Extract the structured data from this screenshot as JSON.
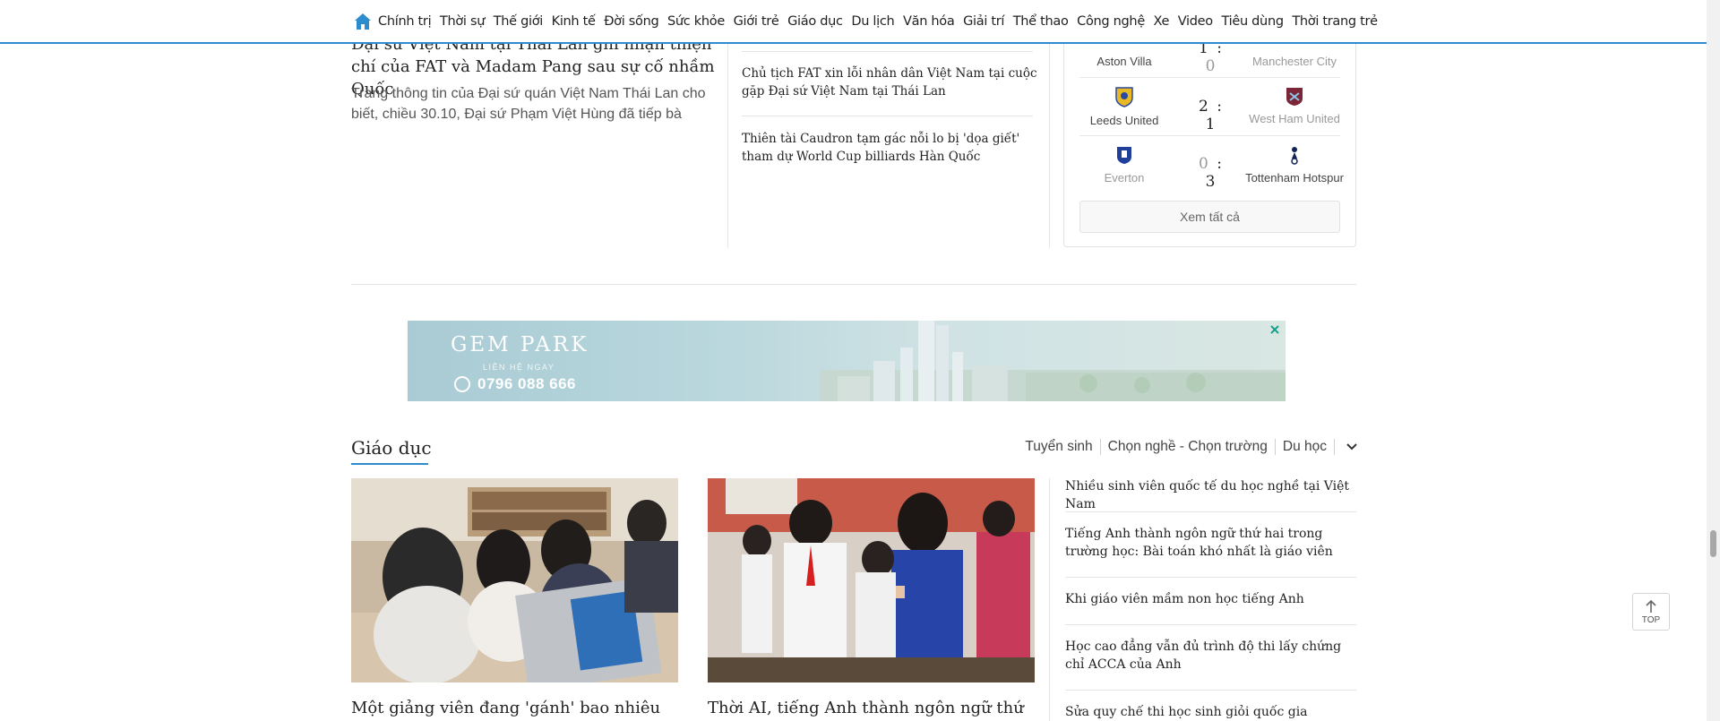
{
  "nav": {
    "items": [
      "Chính trị",
      "Thời sự",
      "Thế giới",
      "Kinh tế",
      "Đời sống",
      "Sức khỏe",
      "Giới trẻ",
      "Giáo dục",
      "Du lịch",
      "Văn hóa",
      "Giải trí",
      "Thể thao",
      "Công nghệ",
      "Xe",
      "Video",
      "Tiêu dùng",
      "Thời trang trẻ"
    ],
    "accent": "#2d8ccd"
  },
  "lead": {
    "title": "Đại sứ Việt Nam tại Thái Lan ghi nhận thiện chí của FAT và Madam Pang sau sự cố nhầm Quốc",
    "sapo": "Trang thông tin của Đại sứ quán Việt Nam Thái Lan cho biết, chiều 30.10, Đại sứ Phạm Việt Hùng đã tiếp bà"
  },
  "related": [
    "Chủ tịch FAT xin lỗi nhân dân Việt Nam tại cuộc gặp Đại sứ Việt Nam tại Thái Lan",
    "Thiên tài Caudron tạm gác nỗi lo bị 'dọa giết' tham dự World Cup billiards Hàn Quốc"
  ],
  "scores": {
    "matches": [
      {
        "home": "Aston Villa",
        "away": "Manchester City",
        "home_score": "1",
        "away_score": "0"
      },
      {
        "home": "Leeds United",
        "away": "West Ham United",
        "home_score": "2",
        "away_score": "1"
      },
      {
        "home": "Everton",
        "away": "Tottenham Hotspur",
        "home_score": "0",
        "away_score": "3"
      }
    ],
    "see_all": "Xem tất cả"
  },
  "ad": {
    "brand": "GEM PARK",
    "cta": "LIÊN HỆ NGAY",
    "phone": "0796 088 666"
  },
  "section": {
    "title": "Giáo dục",
    "tabs": [
      "Tuyển sinh",
      "Chọn nghề - Chọn trường",
      "Du học"
    ],
    "cards": [
      {
        "title": "Một giảng viên đang 'gánh' bao nhiêu"
      },
      {
        "title": "Thời AI, tiếng Anh thành ngôn ngữ thứ"
      }
    ],
    "side": [
      "Nhiều sinh viên quốc tế du học nghề tại Việt Nam",
      "Tiếng Anh thành ngôn ngữ thứ hai trong trường học: Bài toán khó nhất là giáo viên",
      "Khi giáo viên mầm non học tiếng Anh",
      "Học cao đẳng vẫn đủ trình độ thi lấy chứng chỉ ACCA của Anh",
      "Sửa quy chế thi học sinh giỏi quốc gia"
    ]
  },
  "top_button": "TOP"
}
